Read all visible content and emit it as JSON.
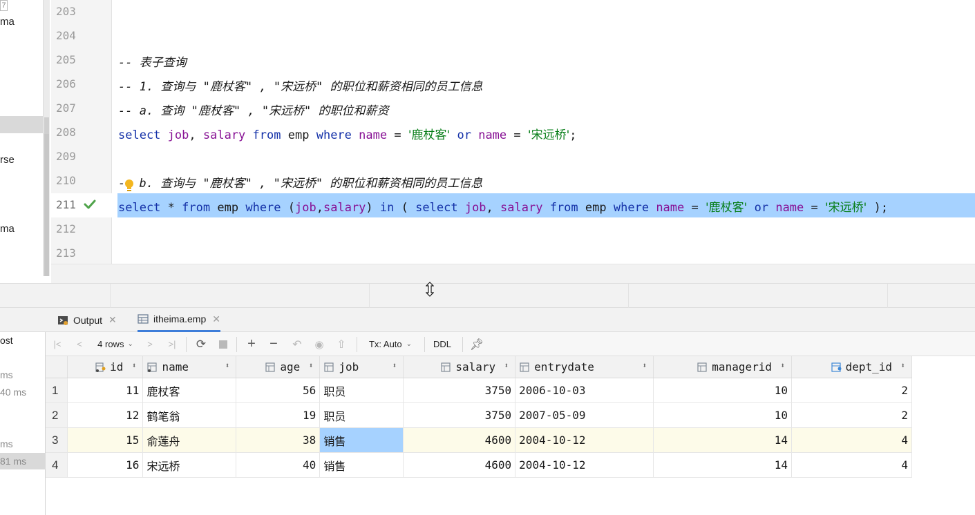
{
  "left_panel": {
    "badge": "7",
    "fragments": [
      "ma",
      "rse",
      "ma"
    ]
  },
  "editor": {
    "lines": [
      {
        "num": "203"
      },
      {
        "num": "204"
      },
      {
        "num": "205",
        "comment": "-- 表子查询"
      },
      {
        "num": "206",
        "comment": "-- 1. 查询与 \"鹿杖客\" , \"宋远桥\" 的职位和薪资相同的员工信息"
      },
      {
        "num": "207",
        "comment": "-- a. 查询 \"鹿杖客\" , \"宋远桥\" 的职位和薪资"
      },
      {
        "num": "208",
        "code": "select job, salary from emp where name = '鹿杖客' or name = '宋远桥';"
      },
      {
        "num": "209"
      },
      {
        "num": "210",
        "comment_lead": "-",
        "comment": " b. 查询与 \"鹿杖客\" , \"宋远桥\" 的职位和薪资相同的员工信息"
      },
      {
        "num": "211",
        "code": "select * from emp where (job,salary) in ( select job, salary from emp where name = '鹿杖客' or name = '宋远桥' );"
      },
      {
        "num": "212"
      },
      {
        "num": "213"
      }
    ],
    "tokens_208": {
      "kw1": "select",
      "c1": "job",
      "p1": ", ",
      "c2": "salary",
      "kw2": "from",
      "t": "emp",
      "kw3": "where",
      "c3": "name",
      "eq": "=",
      "s1": "'鹿杖客'",
      "kw4": "or",
      "c4": "name",
      "s2": "'宋远桥'",
      "end": ";"
    },
    "tokens_211": {
      "kw1": "select",
      "star": "*",
      "kw2": "from",
      "t": "emp",
      "kw3": "where",
      "lp": "(",
      "c1": "job",
      "comma": ",",
      "c2": "salary",
      "rp": ")",
      "kw4": "in",
      "lp2": "(",
      "kw5": "select",
      "c3": "job",
      "c4": "salary",
      "kw6": "from",
      "t2": "emp",
      "kw7": "where",
      "c5": "name",
      "s1": "'鹿杖客'",
      "kw8": "or",
      "c6": "name",
      "s2": "'宋远桥'",
      "end": ");"
    }
  },
  "services_panel": {
    "fragments": [
      {
        "text": "ost"
      },
      {
        "text": "ms"
      },
      {
        "text": "40 ms"
      },
      {
        "text": "ms"
      },
      {
        "text": "81 ms"
      }
    ]
  },
  "tabs": [
    {
      "label": "Output",
      "icon": "console-icon"
    },
    {
      "label": "itheima.emp",
      "icon": "table-icon",
      "active": true
    }
  ],
  "toolbar": {
    "rows_label": "4 rows",
    "tx_label": "Tx: Auto",
    "ddl_label": "DDL"
  },
  "grid": {
    "columns": [
      "id",
      "name",
      "age",
      "job",
      "salary",
      "entrydate",
      "managerid",
      "dept_id"
    ],
    "rows": [
      {
        "rn": "1",
        "id": "11",
        "name": "鹿杖客",
        "age": "56",
        "job": "职员",
        "salary": "3750",
        "entrydate": "2006-10-03",
        "managerid": "10",
        "dept_id": "2"
      },
      {
        "rn": "2",
        "id": "12",
        "name": "鹤笔翁",
        "age": "19",
        "job": "职员",
        "salary": "3750",
        "entrydate": "2007-05-09",
        "managerid": "10",
        "dept_id": "2"
      },
      {
        "rn": "3",
        "id": "15",
        "name": "俞莲舟",
        "age": "38",
        "job": "销售",
        "salary": "4600",
        "entrydate": "2004-10-12",
        "managerid": "14",
        "dept_id": "4"
      },
      {
        "rn": "4",
        "id": "16",
        "name": "宋远桥",
        "age": "40",
        "job": "销售",
        "salary": "4600",
        "entrydate": "2004-10-12",
        "managerid": "14",
        "dept_id": "4"
      }
    ]
  },
  "colors": {
    "keyword": "#1431a8",
    "column": "#871094",
    "string": "#067d17",
    "comment": "#8c8c8c",
    "selection": "#a6d2ff",
    "check": "#4fa34a"
  }
}
